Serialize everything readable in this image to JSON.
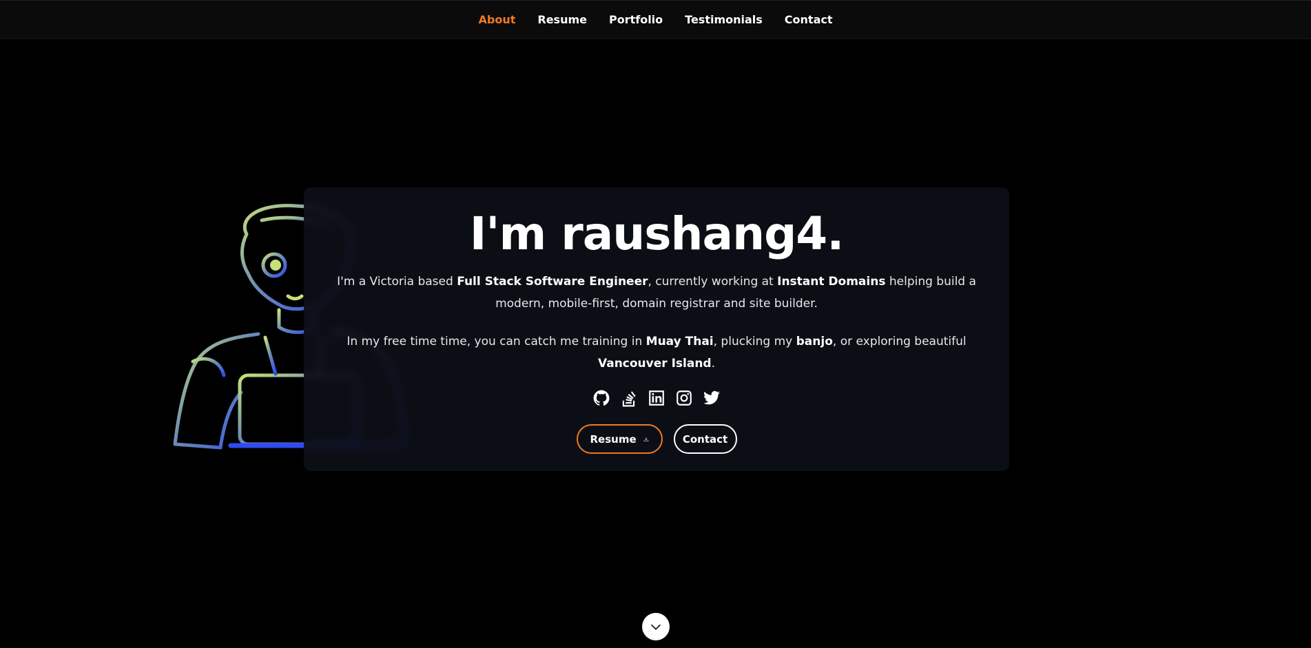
{
  "nav": {
    "items": [
      {
        "label": "About",
        "active": true
      },
      {
        "label": "Resume",
        "active": false
      },
      {
        "label": "Portfolio",
        "active": false
      },
      {
        "label": "Testimonials",
        "active": false
      },
      {
        "label": "Contact",
        "active": false
      }
    ]
  },
  "hero": {
    "title": "I'm raushang4.",
    "para1": {
      "t1": "I'm a Victoria based ",
      "b1": "Full Stack Software Engineer",
      "t2": ", currently working at ",
      "b2": "Instant Domains",
      "t3": " helping build a modern, mobile-first, domain registrar and site builder."
    },
    "para2": {
      "t1": "In my free time time, you can catch me training in ",
      "b1": "Muay Thai",
      "t2": ", plucking my ",
      "b2": "banjo",
      "t3": ", or exploring beautiful ",
      "b3": "Vancouver Island",
      "t4": "."
    },
    "socials": [
      "github-icon",
      "stackoverflow-icon",
      "linkedin-icon",
      "instagram-icon",
      "twitter-icon"
    ],
    "buttons": {
      "resume_label": "Resume",
      "contact_label": "Contact"
    }
  },
  "colors": {
    "accent": "#f07b22",
    "background": "#000000",
    "card": "#0d1018",
    "nav_bg": "#0b0b0c"
  }
}
